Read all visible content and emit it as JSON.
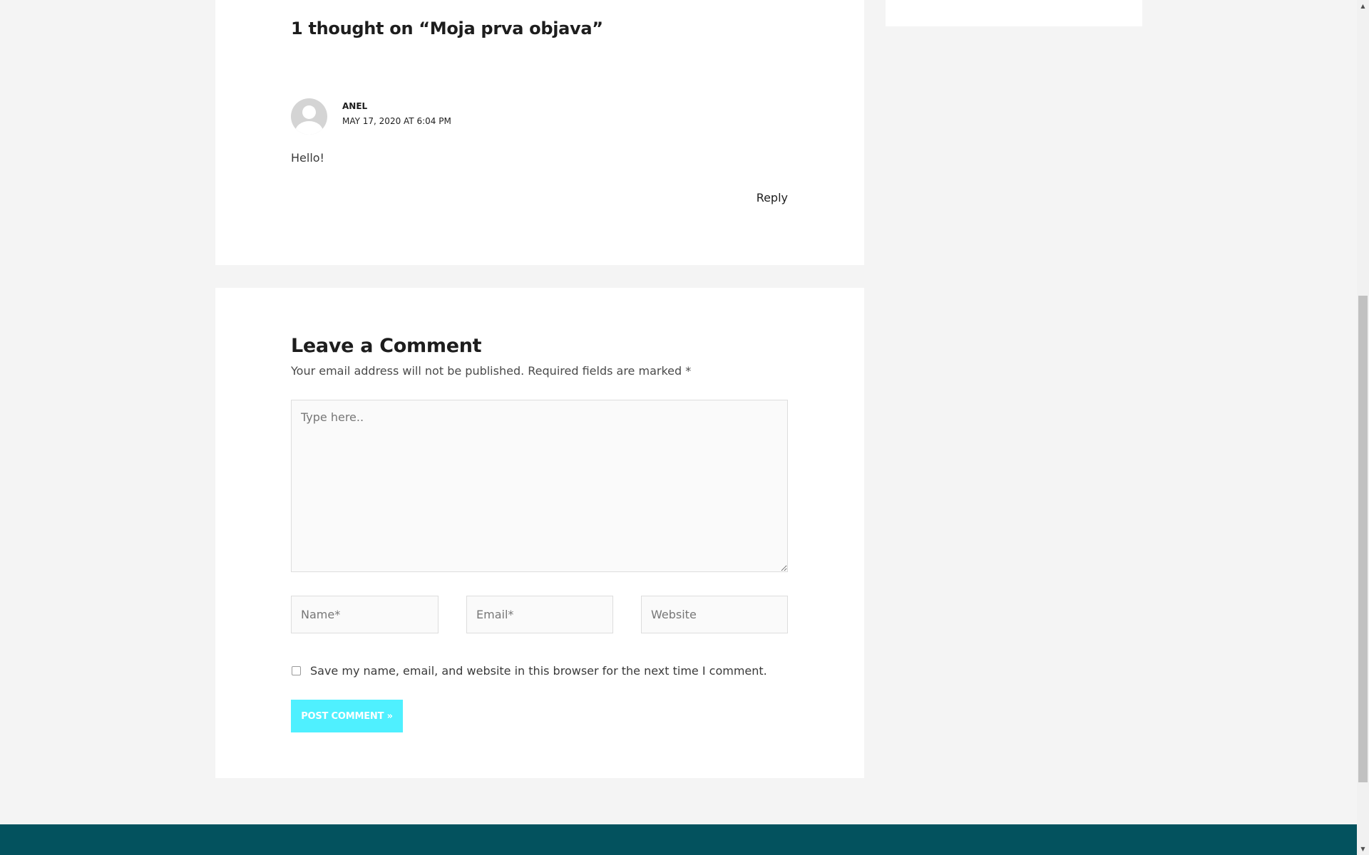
{
  "comments": {
    "title": "1 thought on “Moja prva objava”",
    "items": [
      {
        "author": "ANEL",
        "date": "MAY 17, 2020 AT 6:04 PM",
        "text": "Hello!",
        "reply_label": "Reply",
        "avatar_icon": "default-user-avatar-icon"
      }
    ]
  },
  "respond": {
    "title": "Leave a Comment",
    "notes": "Your email address will not be published. Required fields are marked",
    "required_marker": "*",
    "comment_placeholder": "Type here..",
    "name_placeholder": "Name*",
    "email_placeholder": "Email*",
    "website_placeholder": "Website",
    "consent_label": "Save my name, email, and website in this browser for the next time I comment.",
    "consent_checked": false,
    "submit_label": "Post Comment »"
  },
  "colors": {
    "page_background": "#f4f4f4",
    "card_background": "#ffffff",
    "accent_button": "#4ff0ff",
    "footer": "#03525e",
    "heading_text": "#1d1d1d"
  },
  "scrollbar": {
    "up_icon": "scroll-up-arrow-icon",
    "down_icon": "scroll-down-arrow-icon"
  }
}
